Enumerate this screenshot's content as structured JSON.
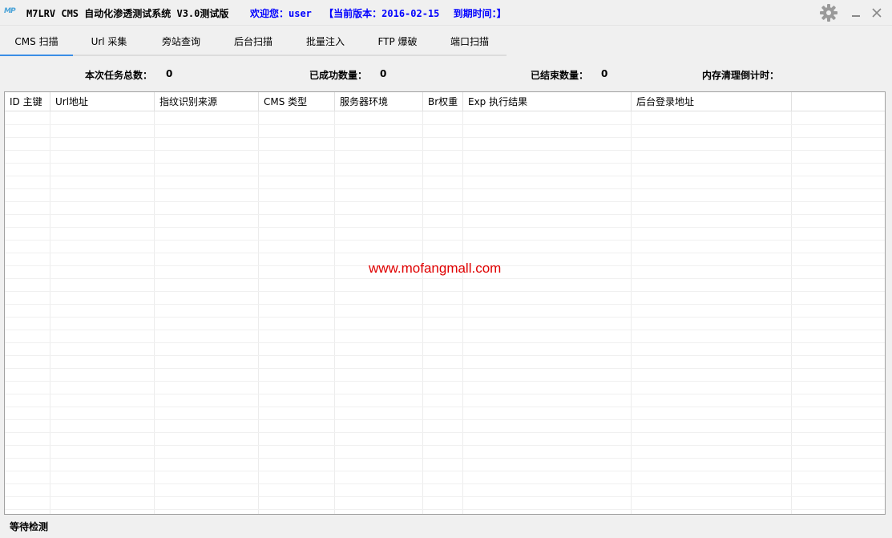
{
  "titlebar": {
    "app_icon": "MP",
    "title": "M7LRV CMS 自动化渗透测试系统 V3.0测试版",
    "welcome": "欢迎您：user",
    "version": "【当前版本：2016-02-15",
    "expire": "到期时间：】",
    "settings_icon": "gear-icon",
    "minimize_icon": "minimize-icon",
    "close_icon": "close-icon"
  },
  "tabs": [
    {
      "label": "CMS 扫描",
      "active": true
    },
    {
      "label": "Url 采集"
    },
    {
      "label": "旁站查询"
    },
    {
      "label": "后台扫描"
    },
    {
      "label": "批量注入"
    },
    {
      "label": "FTP 爆破"
    },
    {
      "label": "端口扫描"
    }
  ],
  "stats": {
    "total_label": "本次任务总数：",
    "total_value": "0",
    "success_label": "已成功数量：",
    "success_value": "0",
    "finished_label": "已结束数量：",
    "finished_value": "0",
    "memory_label": "内存清理倒计时："
  },
  "table": {
    "columns": [
      "ID 主键",
      "Url地址",
      "指纹识别来源",
      "CMS 类型",
      "服务器环境",
      "Br权重",
      "Exp 执行结果",
      "后台登录地址"
    ],
    "rows": []
  },
  "watermark": "www.mofangmall.com",
  "status": "等待检测",
  "colors": {
    "accent": "#3a8ee6",
    "welcome_text": "#0000ff",
    "watermark": "#e00000"
  }
}
